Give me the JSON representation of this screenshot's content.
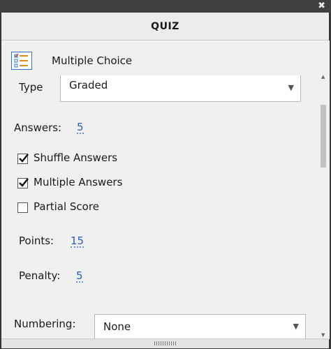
{
  "panel": {
    "title": "QUIZ"
  },
  "quiz": {
    "icon": "multiple-choice-list-icon",
    "title": "Multiple Choice"
  },
  "type": {
    "label": "Type",
    "value": "Graded"
  },
  "answers": {
    "label": "Answers:",
    "value": "5"
  },
  "options": [
    {
      "label": "Shuffle Answers",
      "checked": true
    },
    {
      "label": "Multiple Answers",
      "checked": true
    },
    {
      "label": "Partial Score",
      "checked": false
    }
  ],
  "points": {
    "label": "Points:",
    "value": "15"
  },
  "penalty": {
    "label": "Penalty:",
    "value": "5"
  },
  "numbering": {
    "label": "Numbering:",
    "value": "None"
  },
  "colors": {
    "link": "#2a5fb0",
    "icon_accent": "#2f74c4",
    "titlebar": "#3f3f3f"
  }
}
